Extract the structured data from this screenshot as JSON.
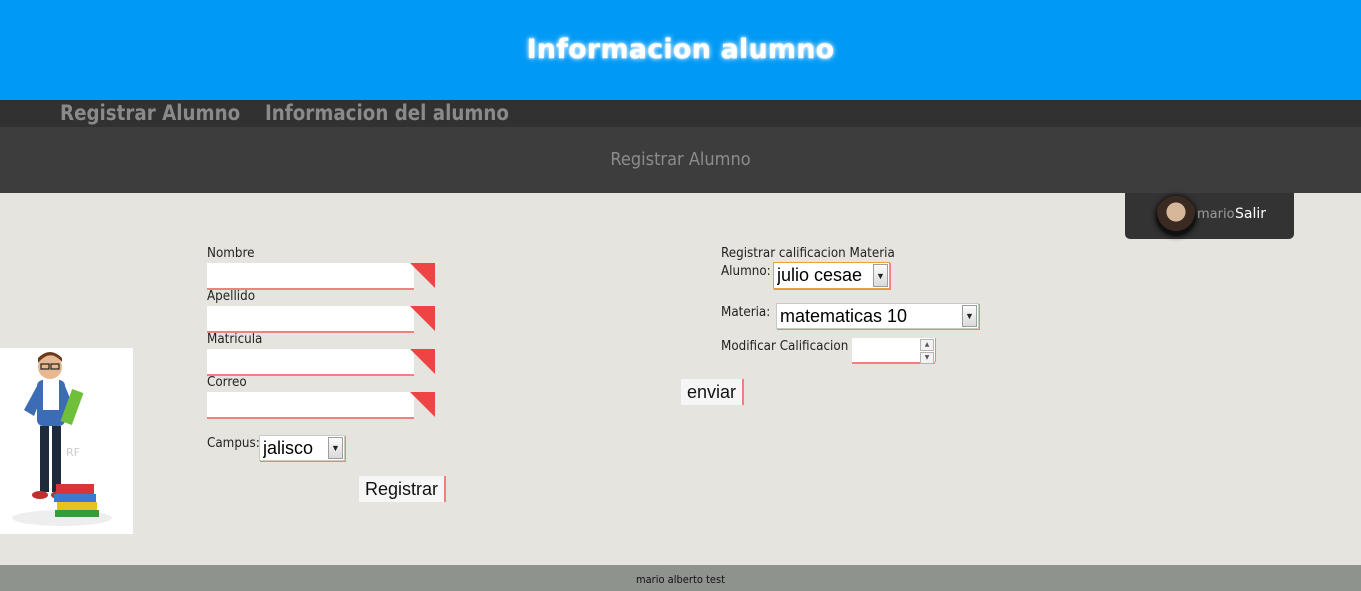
{
  "header": {
    "title": "Informacion alumno"
  },
  "nav": {
    "items": [
      "Registrar Alumno",
      "Informacion del alumno"
    ]
  },
  "subheader": {
    "title": "Registrar Alumno"
  },
  "user": {
    "name": "mario",
    "logout_label": "Salir"
  },
  "register_form": {
    "fields": [
      {
        "label": "Nombre",
        "value": ""
      },
      {
        "label": "Apellido",
        "value": ""
      },
      {
        "label": "Matricula",
        "value": ""
      },
      {
        "label": "Correo",
        "value": ""
      }
    ],
    "campus_label": "Campus:",
    "campus_value": "jalisco",
    "submit_label": "Registrar"
  },
  "grade_form": {
    "title": "Registrar calificacion Materia",
    "student_label": "Alumno:",
    "student_value": "julio cesae",
    "subject_label": "Materia:",
    "subject_value": "matematicas 10",
    "grade_label": "Modificar Calificacion",
    "grade_value": "",
    "submit_label": "enviar"
  },
  "footer": {
    "text": "mario alberto test"
  },
  "colors": {
    "header_bg": "#0099f5",
    "nav_bg": "#313131",
    "subheader_bg": "#3d3d3d",
    "accent_red": "#ee4444",
    "footer_bg": "#8f938e"
  }
}
